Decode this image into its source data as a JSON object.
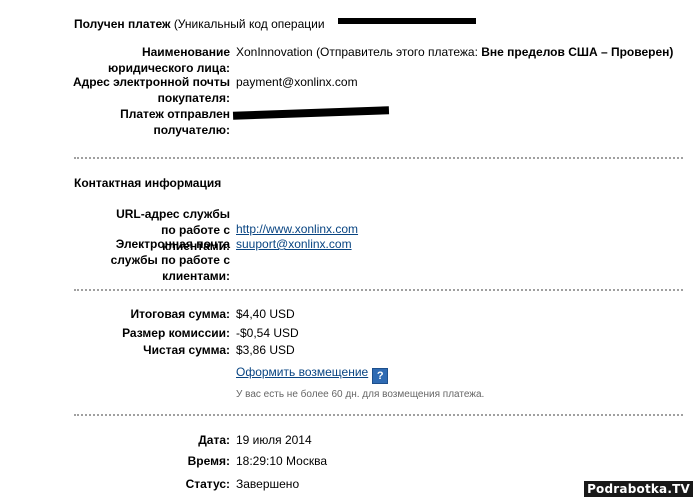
{
  "header": {
    "title": "Получен платеж",
    "code_label": "(Уникальный код операции",
    "code_tail": "..."
  },
  "payer": {
    "entity_label": "Наименование юридического лица:",
    "entity_value": "XonInnovation (Отправитель этого платежа:",
    "entity_status": "Вне пределов США – Проверен)",
    "email_label": "Адрес электронной почты покупателя:",
    "email_value": "payment@xonlinx.com",
    "sent_to_label": "Платеж отправлен получателю:"
  },
  "contact": {
    "heading": "Контактная информация",
    "url_label": "URL-адрес службы по работе с клиентами:",
    "url_value": "http://www.xonlinx.com",
    "support_email_label": "Электронная почта службы по работе с клиентами:",
    "support_email_value": "suuport@xonlinx.com"
  },
  "amounts": {
    "total_label": "Итоговая сумма:",
    "total_value": "$4,40 USD",
    "fee_label": "Размер комиссии:",
    "fee_value": "-$0,54 USD",
    "net_label": "Чистая сумма:",
    "net_value": "$3,86 USD",
    "refund_link": "Оформить возмещение",
    "help_glyph": "?",
    "refund_note": "У вас есть не более 60 дн. для возмещения платежа."
  },
  "details": {
    "date_label": "Дата:",
    "date_value": "19 июля 2014",
    "time_label": "Время:",
    "time_value": "18:29:10 Москва",
    "status_label": "Статус:",
    "status_value": "Завершено"
  },
  "watermark": "Podrabotka.TV",
  "colors": {
    "link": "#084482",
    "help_icon": "#2f6bb3",
    "separator": "#a0a0a0"
  }
}
